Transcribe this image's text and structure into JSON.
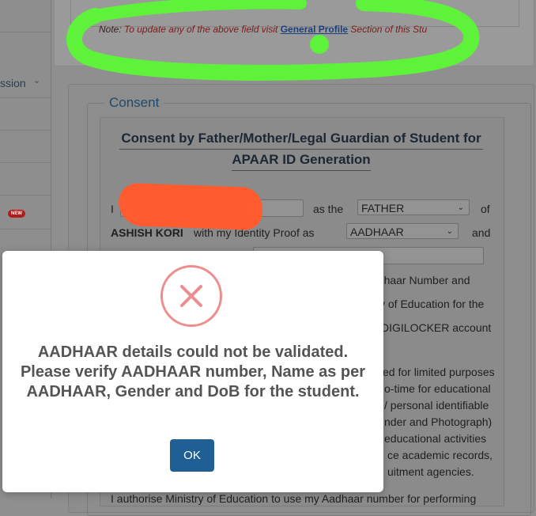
{
  "sidebar": {
    "items": [
      {
        "label": "ssion",
        "has_chevron": true
      },
      {
        "label": ""
      },
      {
        "label": ""
      },
      {
        "label": ""
      },
      {
        "label": "",
        "badge": "NEW"
      }
    ]
  },
  "note": {
    "prefix": "Note:",
    "text_before": " To update any of the above field visit ",
    "link": "General Profile",
    "text_after": " Section of this Stu"
  },
  "consent": {
    "legend": "Consent",
    "title_line1": "Consent by Father/Mother/Legal Guardian of Student for",
    "title_line2": "APAAR ID Generation",
    "i_label": "I",
    "as_the": "as the",
    "relation_selected": "FATHER",
    "of_label": "of",
    "student_name": "ASHISH KORI",
    "with_identity": "with my Identity Proof as",
    "id_proof_selected": "AADHAAR",
    "and_label": "and",
    "fragments": [
      "adhaar Number and",
      "y of Education for the",
      "DIGILOCKER account",
      "ed for limited purposes",
      "o-time for educational",
      "/ personal identifiable",
      "nder and Photograph)",
      " educational activities",
      "ce academic records,",
      "uitment agencies."
    ],
    "bottom_line": "I authorise Ministry of Education to use my Aadhaar number for performing"
  },
  "modal": {
    "icon": "error-x-icon",
    "message": "AADHAAR details could not be validated. Please verify AADHAAR number, Name as per AADHAAR, Gender and DoB for the student.",
    "ok_label": "OK",
    "colors": {
      "icon": "#ee8d8d",
      "button": "#1f5f94",
      "text": "#545454"
    }
  }
}
